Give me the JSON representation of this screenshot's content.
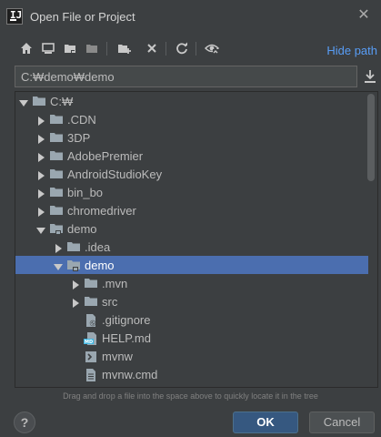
{
  "window": {
    "title": "Open File or Project",
    "app_icon": "intellij-icon"
  },
  "toolbar": {
    "buttons": [
      "home-icon",
      "desktop-icon",
      "project-folder-icon",
      "module-folder-icon",
      "new-folder-icon",
      "delete-icon",
      "refresh-icon",
      "show-hidden-icon"
    ],
    "hide_path_label": "Hide path"
  },
  "path": {
    "value": "C:₩demo₩demo"
  },
  "tree": {
    "items": [
      {
        "label": "C:₩",
        "state": "expanded",
        "kind": "drive"
      },
      {
        "label": ".CDN",
        "state": "collapsed",
        "kind": "folder"
      },
      {
        "label": "3DP",
        "state": "collapsed",
        "kind": "folder"
      },
      {
        "label": "AdobePremier",
        "state": "collapsed",
        "kind": "folder"
      },
      {
        "label": "AndroidStudioKey",
        "state": "collapsed",
        "kind": "folder"
      },
      {
        "label": "bin_bo",
        "state": "collapsed",
        "kind": "folder"
      },
      {
        "label": "chromedriver",
        "state": "collapsed",
        "kind": "folder"
      },
      {
        "label": "demo",
        "state": "expanded",
        "kind": "project-folder"
      },
      {
        "label": ".idea",
        "state": "collapsed",
        "kind": "folder"
      },
      {
        "label": "demo",
        "state": "expanded",
        "kind": "project-folder",
        "selected": true
      },
      {
        "label": ".mvn",
        "state": "collapsed",
        "kind": "folder"
      },
      {
        "label": "src",
        "state": "collapsed",
        "kind": "folder"
      },
      {
        "label": ".gitignore",
        "state": "leaf",
        "kind": "gitignore-file"
      },
      {
        "label": "HELP.md",
        "state": "leaf",
        "kind": "markdown-file"
      },
      {
        "label": "mvnw",
        "state": "leaf",
        "kind": "script-file"
      },
      {
        "label": "mvnw.cmd",
        "state": "leaf",
        "kind": "text-file"
      }
    ]
  },
  "hint": "Drag and drop a file into the space above to quickly locate it in the tree",
  "buttons": {
    "help": "?",
    "ok": "OK",
    "cancel": "Cancel"
  },
  "colors": {
    "accent": "#589df6",
    "selection": "#4b6eaf",
    "background": "#3c3f41",
    "ok_button": "#365880"
  }
}
